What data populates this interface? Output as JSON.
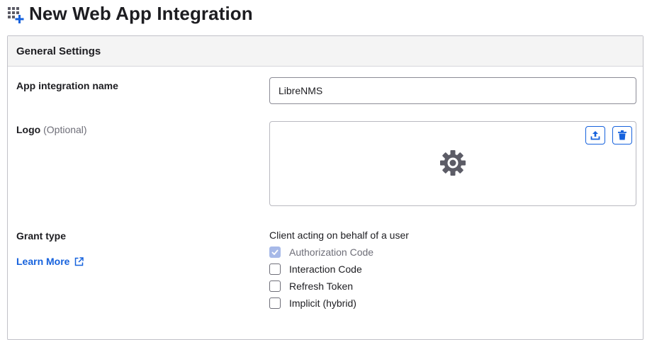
{
  "page": {
    "title": "New Web App Integration",
    "icon": "grid-plus-icon"
  },
  "panel": {
    "title": "General Settings"
  },
  "fields": {
    "app_name": {
      "label": "App integration name",
      "value": "LibreNMS"
    },
    "logo": {
      "label": "Logo",
      "optional": "(Optional)",
      "upload_icon": "upload-icon",
      "delete_icon": "trash-icon",
      "placeholder_icon": "gear-icon"
    },
    "grant_type": {
      "label": "Grant type",
      "learn_more": "Learn More",
      "heading": "Client acting on behalf of a user",
      "options": [
        {
          "label": "Authorization Code",
          "checked": true,
          "disabled": true
        },
        {
          "label": "Interaction Code",
          "checked": false,
          "disabled": false
        },
        {
          "label": "Refresh Token",
          "checked": false,
          "disabled": false
        },
        {
          "label": "Implicit (hybrid)",
          "checked": false,
          "disabled": false
        }
      ]
    }
  },
  "colors": {
    "link": "#1662dd",
    "border": "#c1c1c8",
    "header_bg": "#f4f4f4",
    "checkbox_disabled": "#a7b9e8"
  }
}
